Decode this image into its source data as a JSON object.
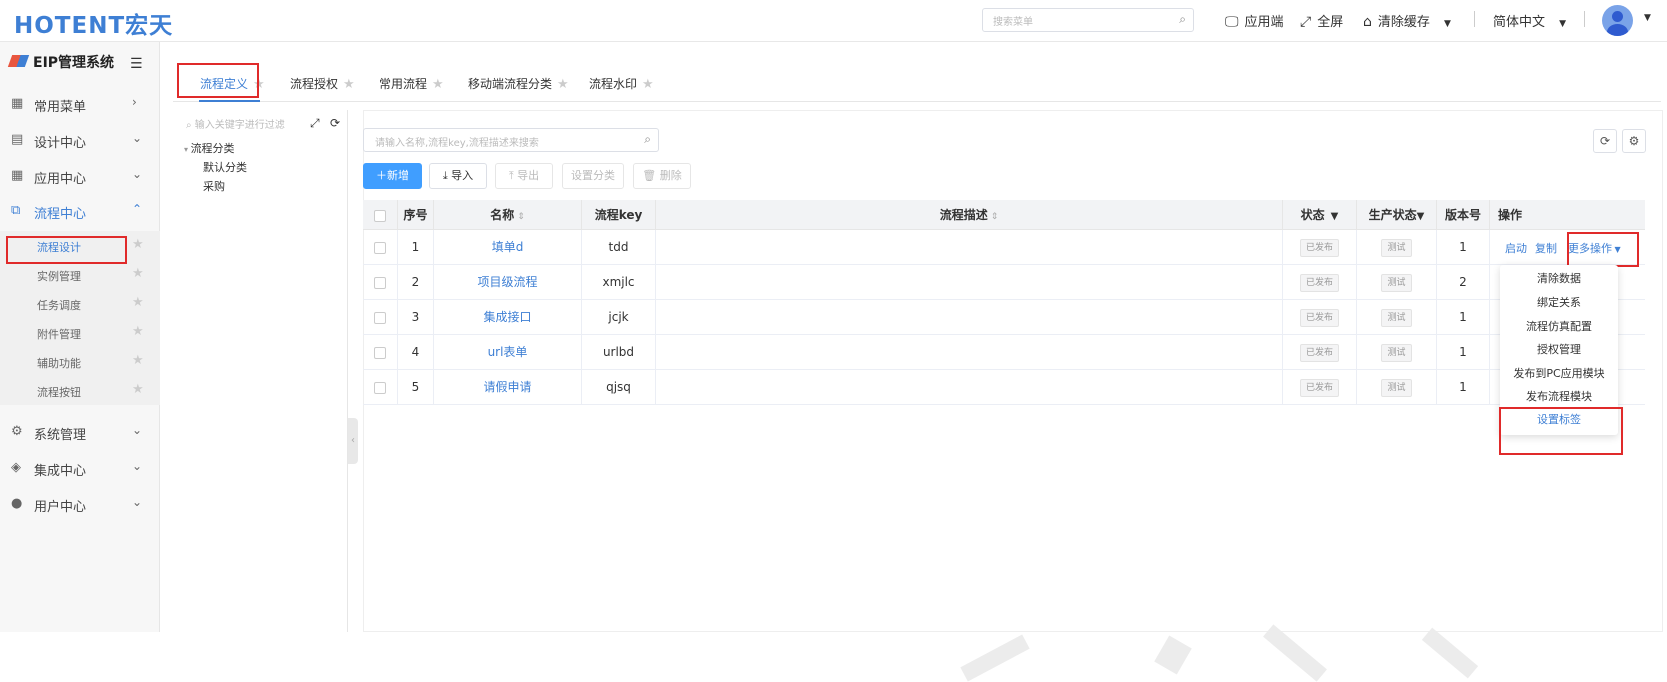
{
  "header": {
    "logo": "HOTENT宏天",
    "search_placeholder": "搜索菜单",
    "search_icon": "search-icon",
    "app_label": "应用端",
    "fullscreen_label": "全屏",
    "clear_cache_label": "清除缓存",
    "language_label": "简体中文"
  },
  "sidebar": {
    "system_title": "EIP管理系统",
    "menus": [
      {
        "label": "常用菜单",
        "icon": "grid-icon"
      },
      {
        "label": "设计中心",
        "icon": "design-icon"
      },
      {
        "label": "应用中心",
        "icon": "apps-icon"
      },
      {
        "label": "流程中心",
        "icon": "flow-icon"
      },
      {
        "label": "系统管理",
        "icon": "gear-icon"
      },
      {
        "label": "集成中心",
        "icon": "layers-icon"
      },
      {
        "label": "用户中心",
        "icon": "user-icon"
      }
    ],
    "submenus": [
      {
        "label": "流程设计"
      },
      {
        "label": "实例管理"
      },
      {
        "label": "任务调度"
      },
      {
        "label": "附件管理"
      },
      {
        "label": "辅助功能"
      },
      {
        "label": "流程按钮"
      }
    ]
  },
  "tabs": [
    {
      "label": "流程定义"
    },
    {
      "label": "流程授权"
    },
    {
      "label": "常用流程"
    },
    {
      "label": "移动端流程分类"
    },
    {
      "label": "流程水印"
    }
  ],
  "tree": {
    "filter_placeholder": "输入关键字进行过滤",
    "root": "流程分类",
    "children": [
      "默认分类",
      "采购"
    ]
  },
  "main": {
    "search_placeholder": "请输入名称,流程key,流程描述来搜索",
    "buttons": {
      "add": "新增",
      "import": "导入",
      "export": "导出",
      "set_category": "设置分类",
      "delete": "删除"
    }
  },
  "table": {
    "headers": {
      "index": "序号",
      "name": "名称",
      "key": "流程key",
      "desc": "流程描述",
      "status": "状态",
      "prod_status": "生产状态",
      "version": "版本号",
      "ops": "操作"
    },
    "rows": [
      {
        "index": "1",
        "name": "填单d",
        "key": "tdd",
        "status": "已发布",
        "prod_status": "测试",
        "version": "1"
      },
      {
        "index": "2",
        "name": "项目级流程",
        "key": "xmjlc",
        "status": "已发布",
        "prod_status": "测试",
        "version": "2"
      },
      {
        "index": "3",
        "name": "集成接口",
        "key": "jcjk",
        "status": "已发布",
        "prod_status": "测试",
        "version": "1"
      },
      {
        "index": "4",
        "name": "url表单",
        "key": "urlbd",
        "status": "已发布",
        "prod_status": "测试",
        "version": "1"
      },
      {
        "index": "5",
        "name": "请假申请",
        "key": "qjsq",
        "status": "已发布",
        "prod_status": "测试",
        "version": "1"
      }
    ],
    "row_ops": {
      "start": "启动",
      "copy": "复制",
      "more": "更多操作"
    }
  },
  "dropdown": {
    "items": [
      "清除数据",
      "绑定关系",
      "流程仿真配置",
      "授权管理",
      "发布到PC应用模块",
      "发布流程模块",
      "设置标签"
    ]
  }
}
